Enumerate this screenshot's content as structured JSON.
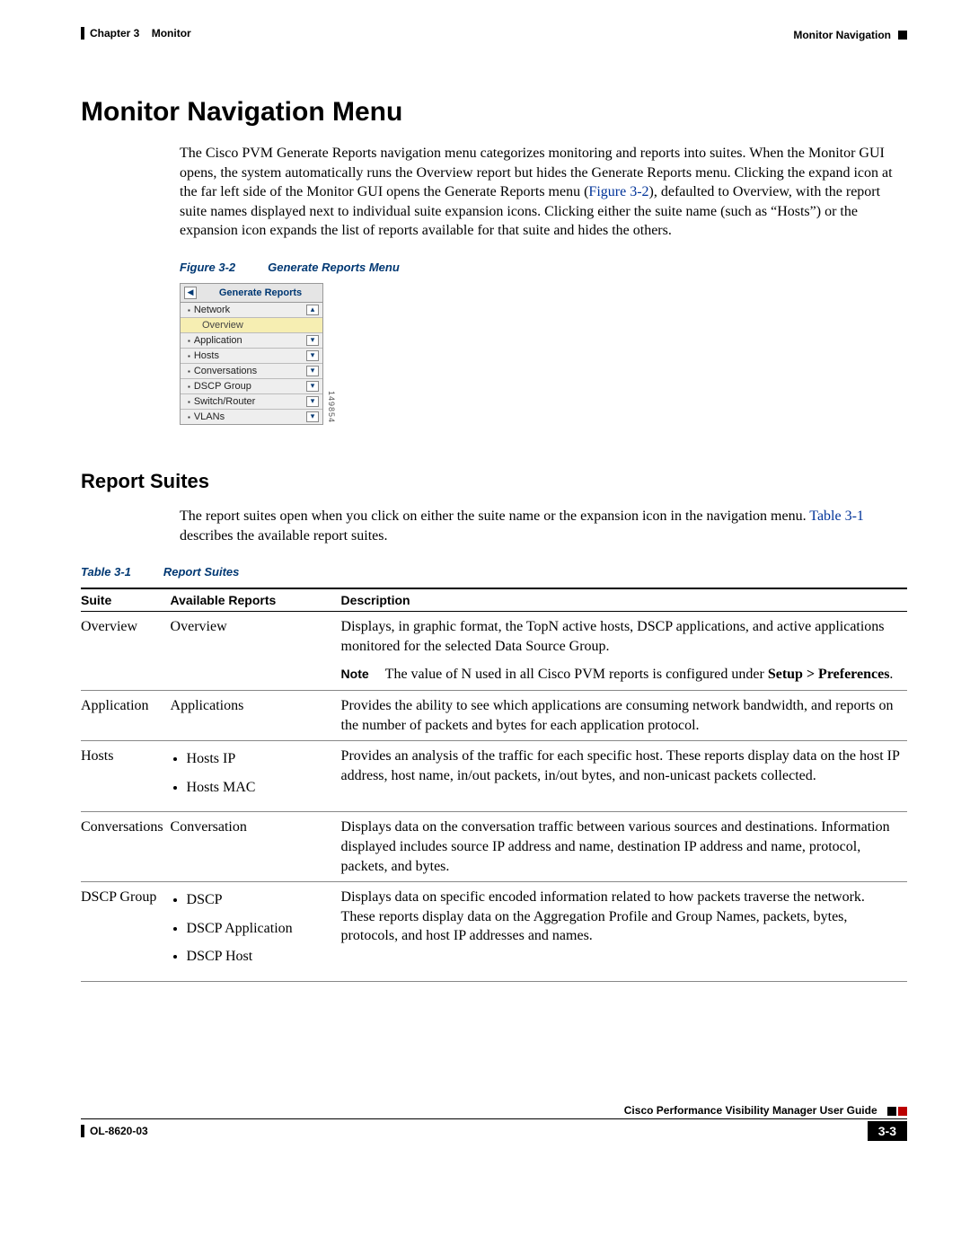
{
  "header": {
    "chapter": "Chapter 3",
    "chapterTitle": "Monitor",
    "sectionRight": "Monitor Navigation"
  },
  "h1": "Monitor Navigation Menu",
  "intro": {
    "p1a": "The Cisco PVM Generate Reports navigation menu categorizes monitoring and reports into suites. When the Monitor GUI opens, the system automatically runs the Overview report but hides the Generate Reports menu. Clicking the expand icon at the far left side of the Monitor GUI opens the Generate Reports menu (",
    "figref": "Figure 3-2",
    "p1b": "), defaulted to Overview, with the report suite names displayed next to individual suite expansion icons. Clicking either the suite name (such as “Hosts”) or the expansion icon expands the list of reports available for that suite and hides the others."
  },
  "figure": {
    "label": "Figure 3-2",
    "title": "Generate Reports Menu",
    "sideNumber": "149854",
    "menu": {
      "title": "Generate Reports",
      "items": [
        {
          "label": "Network",
          "expanded": true,
          "sub": "Overview"
        },
        {
          "label": "Application"
        },
        {
          "label": "Hosts"
        },
        {
          "label": "Conversations"
        },
        {
          "label": "DSCP Group"
        },
        {
          "label": "Switch/Router"
        },
        {
          "label": "VLANs"
        }
      ]
    }
  },
  "h2": "Report Suites",
  "suitesIntro": {
    "a": "The report suites open when you click on either the suite name or the expansion icon in the navigation menu. ",
    "tblref": "Table 3-1",
    "b": " describes the available report suites."
  },
  "table": {
    "label": "Table 3-1",
    "title": "Report Suites",
    "headers": {
      "suite": "Suite",
      "reports": "Available Reports",
      "desc": "Description"
    },
    "rows": [
      {
        "suite": "Overview",
        "reports_plain": "Overview",
        "desc": "Displays, in graphic format, the TopN active hosts, DSCP applications, and active applications monitored for the selected Data Source Group.",
        "note": {
          "label": "Note",
          "text": "The value of N used in all Cisco PVM reports is configured under ",
          "bold": "Setup > Preferences",
          "tail": "."
        }
      },
      {
        "suite": "Application",
        "reports_plain": "Applications",
        "desc": "Provides the ability to see which applications are consuming network bandwidth, and reports on the number of packets and bytes for each application protocol."
      },
      {
        "suite": "Hosts",
        "reports_list": [
          "Hosts IP",
          "Hosts MAC"
        ],
        "desc": "Provides an analysis of the traffic for each specific host. These reports display data on the host IP address, host name, in/out packets, in/out bytes, and non-unicast packets collected."
      },
      {
        "suite": "Conversations",
        "reports_plain": "Conversation",
        "desc": "Displays data on the conversation traffic between various sources and destinations. Information displayed includes source IP address and name, destination IP address and name, protocol, packets, and bytes."
      },
      {
        "suite": "DSCP Group",
        "reports_list": [
          "DSCP",
          "DSCP Application",
          "DSCP Host"
        ],
        "desc": "Displays data on specific encoded information related to how packets traverse the network. These reports display data on the Aggregation Profile and Group Names, packets, bytes, protocols, and host IP addresses and names."
      }
    ]
  },
  "footer": {
    "guide": "Cisco Performance Visibility Manager User Guide",
    "docnum": "OL-8620-03",
    "page": "3-3"
  }
}
